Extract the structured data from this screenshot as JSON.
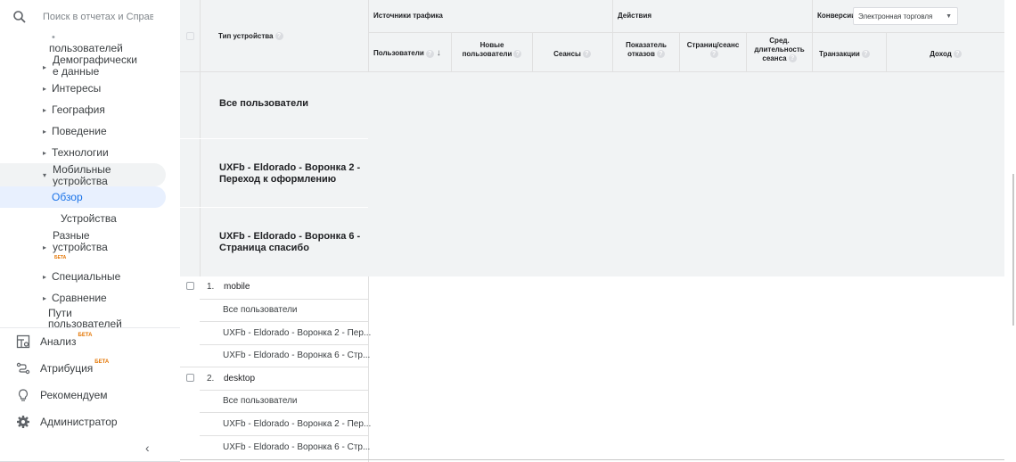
{
  "search": {
    "placeholder": "Поиск в отчетах и Справке"
  },
  "nav": {
    "items": [
      {
        "label": "пользователей",
        "cut": true
      },
      {
        "label": "Демографически\nе данные"
      },
      {
        "label": "Интересы"
      },
      {
        "label": "География"
      },
      {
        "label": "Поведение"
      },
      {
        "label": "Технологии"
      },
      {
        "label": "Мобильные\nустройства"
      },
      {
        "label": "Обзор"
      },
      {
        "label": "Устройства"
      },
      {
        "label": "Разные\nустройства",
        "badge": "БЕТА"
      },
      {
        "label": "Специальные"
      },
      {
        "label": "Сравнение"
      },
      {
        "label": "Пути\nпользователей"
      }
    ],
    "main": [
      {
        "label": "Анализ",
        "badge": "БЕТА"
      },
      {
        "label": "Атрибуция",
        "badge": "БЕТА"
      },
      {
        "label": "Рекомендуем"
      },
      {
        "label": "Администратор"
      }
    ]
  },
  "table": {
    "dimension_header": "Тип устройства",
    "groups": {
      "traffic": "Источники трафика",
      "actions": "Действия",
      "conversions": "Конверсии",
      "conversion_select": "Электронная торговля"
    },
    "columns": {
      "users": "Пользователи",
      "new_users": "Новые пользователи",
      "sessions": "Сеансы",
      "bounce_rate": "Показатель отказов",
      "pages_per_session": "Страниц/сеанс",
      "avg_session": "Сред. длительность сеанса",
      "transactions": "Транзакции",
      "revenue": "Доход"
    },
    "segments": [
      "Все пользователи",
      "UXFb - Eldorado - Воронка 2 - Переход к оформлению",
      "UXFb - Eldorado - Воронка 6 - Страница спасибо"
    ],
    "rows": [
      {
        "index": "1.",
        "name": "mobile"
      },
      {
        "sub": "Все пользователи"
      },
      {
        "sub": "UXFb - Eldorado - Воронка 2 - Пер..."
      },
      {
        "sub": "UXFb - Eldorado - Воронка 6 - Стр..."
      },
      {
        "index": "2.",
        "name": "desktop"
      },
      {
        "sub": "Все пользователи"
      },
      {
        "sub": "UXFb - Eldorado - Воронка 2 - Пер..."
      },
      {
        "sub": "UXFb - Eldorado - Воронка 6 - Стр..."
      }
    ]
  }
}
